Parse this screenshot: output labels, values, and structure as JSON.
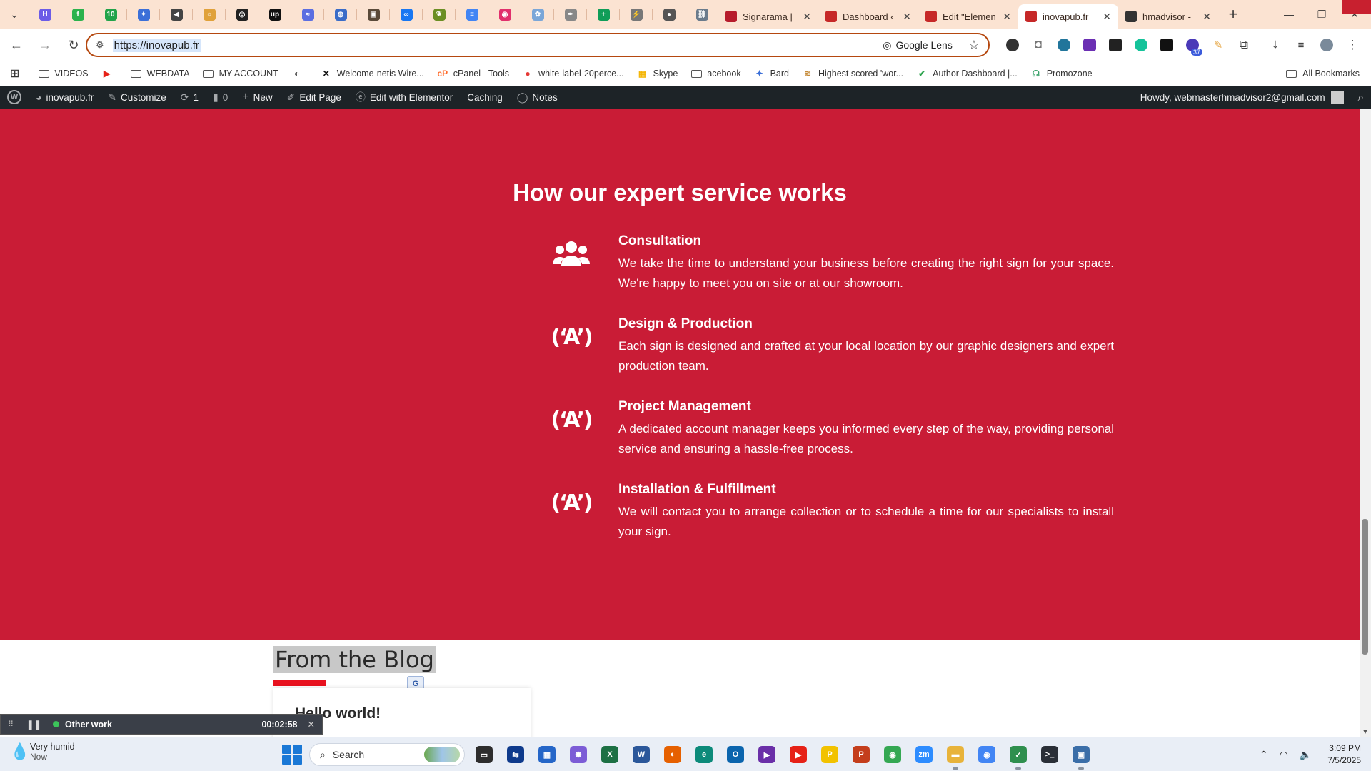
{
  "browser": {
    "pinned_tabs": [
      {
        "icon": "hostinger-icon",
        "color": "#6c5ce7",
        "glyph": "H"
      },
      {
        "icon": "feedly-icon",
        "color": "#2bb24c",
        "glyph": "f"
      },
      {
        "icon": "ten-icon",
        "color": "#22a34a",
        "glyph": "10"
      },
      {
        "icon": "gemini-icon",
        "color": "#3b6fd8",
        "glyph": "✦"
      },
      {
        "icon": "speaker-icon",
        "color": "#444444",
        "glyph": "◀"
      },
      {
        "icon": "ring-icon",
        "color": "#e0a13a",
        "glyph": "○"
      },
      {
        "icon": "openai-icon",
        "color": "#222222",
        "glyph": "◎"
      },
      {
        "icon": "upwork-icon",
        "color": "#111111",
        "glyph": "up"
      },
      {
        "icon": "sync-icon",
        "color": "#5b6ee1",
        "glyph": "≈"
      },
      {
        "icon": "globe-search-icon",
        "color": "#3a6cc8",
        "glyph": "◍"
      },
      {
        "icon": "profile-photo-icon",
        "color": "#5a4a3a",
        "glyph": "▣"
      },
      {
        "icon": "meta-icon",
        "color": "#1877f2",
        "glyph": "∞"
      },
      {
        "icon": "bird-icon",
        "color": "#6b8e23",
        "glyph": "❦"
      },
      {
        "icon": "docs-icon",
        "color": "#4285f4",
        "glyph": "≡"
      },
      {
        "icon": "instagram-icon",
        "color": "#e1306c",
        "glyph": "◉"
      },
      {
        "icon": "settings-icon",
        "color": "#7aa6d8",
        "glyph": "✿"
      },
      {
        "icon": "pen-icon",
        "color": "#888888",
        "glyph": "✒"
      },
      {
        "icon": "sheets-add-icon",
        "color": "#0f9d58",
        "glyph": "+"
      },
      {
        "icon": "zap-icon",
        "color": "#777777",
        "glyph": "⚡"
      },
      {
        "icon": "circle-dot-icon",
        "color": "#555555",
        "glyph": "●"
      },
      {
        "icon": "link-icon",
        "color": "#6a7b8c",
        "glyph": "⛓"
      }
    ],
    "tabs": [
      {
        "title": "Signarama |",
        "color": "#b71c2c",
        "active": false
      },
      {
        "title": "Dashboard ‹",
        "color": "#c62828",
        "active": false
      },
      {
        "title": "Edit \"Elemen",
        "color": "#c62828",
        "active": false
      },
      {
        "title": "inovapub.fr",
        "color": "#c62828",
        "active": true
      },
      {
        "title": "hmadvisor -",
        "color": "#333333",
        "active": false
      }
    ],
    "url": "https://inovapub.fr",
    "lens_label": "Google Lens",
    "extension_badge": "37",
    "bookmarks": [
      {
        "label": "VIDEOS",
        "icon": "folder-icon"
      },
      {
        "label": "",
        "icon": "youtube-icon"
      },
      {
        "label": "WEBDATA",
        "icon": "folder-icon"
      },
      {
        "label": "MY ACCOUNT",
        "icon": "folder-icon"
      },
      {
        "label": "",
        "icon": "globe-icon"
      },
      {
        "label": "Welcome-netis Wire...",
        "icon": "netis-icon"
      },
      {
        "label": "cPanel - Tools",
        "icon": "cpanel-icon"
      },
      {
        "label": "white-label-20perce...",
        "icon": "red-circle-icon"
      },
      {
        "label": "Skype",
        "icon": "windows-grid-icon"
      },
      {
        "label": "acebook",
        "icon": "folder-icon"
      },
      {
        "label": "Bard",
        "icon": "bard-icon"
      },
      {
        "label": "Highest scored 'wor...",
        "icon": "scroll-icon"
      },
      {
        "label": "Author Dashboard |...",
        "icon": "author-icon"
      },
      {
        "label": "Promozone",
        "icon": "promo-icon"
      }
    ],
    "all_bookmarks": "All Bookmarks"
  },
  "wpbar": {
    "site": "inovapub.fr",
    "customize": "Customize",
    "updates": "1",
    "comments": "0",
    "new": "New",
    "edit_page": "Edit Page",
    "elementor": "Edit with Elementor",
    "caching": "Caching",
    "notes": "Notes",
    "howdy": "Howdy, webmasterhmadvisor2@gmail.com"
  },
  "page": {
    "section_title": "How our expert service works",
    "steps": [
      {
        "title": "Consultation",
        "text": "We take the time to understand your business before creating the right sign for your space. We're happy to meet you on site or at our showroom.",
        "icon": "users-icon"
      },
      {
        "title": "Design & Production",
        "text": "Each sign is designed and crafted at your local location by our graphic designers and expert production team.",
        "icon": "broadcast-a-icon"
      },
      {
        "title": "Project Management",
        "text": "A dedicated account manager keeps you informed every step of the way, providing personal service and ensuring a hassle-free process.",
        "icon": "broadcast-a-icon"
      },
      {
        "title": "Installation & Fulfillment",
        "text": "We will contact you to arrange collection or to schedule a time for our specialists to install your sign.",
        "icon": "broadcast-a-icon"
      }
    ],
    "blog_title": "From the Blog",
    "post_title": "Hello world!",
    "colors": {
      "hero_bg": "#c91c36",
      "accent": "#e8121f"
    }
  },
  "timer": {
    "label": "Other work",
    "time": "00:02:58"
  },
  "taskbar": {
    "weather_main": "Very humid",
    "weather_sub": "Now",
    "search_label": "Search",
    "apps": [
      {
        "name": "task-view",
        "color": "#2d2d2d",
        "glyph": "▭",
        "state": ""
      },
      {
        "name": "teamviewer",
        "color": "#0e3a8c",
        "glyph": "⇆",
        "state": ""
      },
      {
        "name": "store",
        "color": "#2566c8",
        "glyph": "▦",
        "state": ""
      },
      {
        "name": "copilot",
        "color": "#7c5cd6",
        "glyph": "✺",
        "state": ""
      },
      {
        "name": "excel",
        "color": "#1d7044",
        "glyph": "X",
        "state": ""
      },
      {
        "name": "word",
        "color": "#2b579a",
        "glyph": "W",
        "state": ""
      },
      {
        "name": "firefox",
        "color": "#e66000",
        "glyph": "◐",
        "state": ""
      },
      {
        "name": "edge",
        "color": "#0c8a7a",
        "glyph": "e",
        "state": ""
      },
      {
        "name": "outlook",
        "color": "#0a64ad",
        "glyph": "O",
        "state": ""
      },
      {
        "name": "visual-studio",
        "color": "#6a2fa8",
        "glyph": "▶",
        "state": ""
      },
      {
        "name": "youtube",
        "color": "#e62117",
        "glyph": "▶",
        "state": ""
      },
      {
        "name": "payoneer",
        "color": "#f2c200",
        "glyph": "P",
        "state": ""
      },
      {
        "name": "powerpoint",
        "color": "#c43e1c",
        "glyph": "P",
        "state": ""
      },
      {
        "name": "chrome",
        "color": "#34a853",
        "glyph": "◉",
        "state": ""
      },
      {
        "name": "zoom",
        "color": "#2d8cff",
        "glyph": "zm",
        "state": ""
      },
      {
        "name": "file-explorer",
        "color": "#e8b33a",
        "glyph": "▬",
        "state": "running"
      },
      {
        "name": "chrome-profile",
        "color": "#4285f4",
        "glyph": "◉",
        "state": "focused"
      },
      {
        "name": "checklist",
        "color": "#2f8f4e",
        "glyph": "✓",
        "state": "running"
      },
      {
        "name": "terminal",
        "color": "#2a2f37",
        "glyph": ">_",
        "state": ""
      },
      {
        "name": "remote-desktop",
        "color": "#3b6ea8",
        "glyph": "▣",
        "state": "running"
      }
    ],
    "time": "3:09 PM",
    "date": "7/5/2025"
  }
}
